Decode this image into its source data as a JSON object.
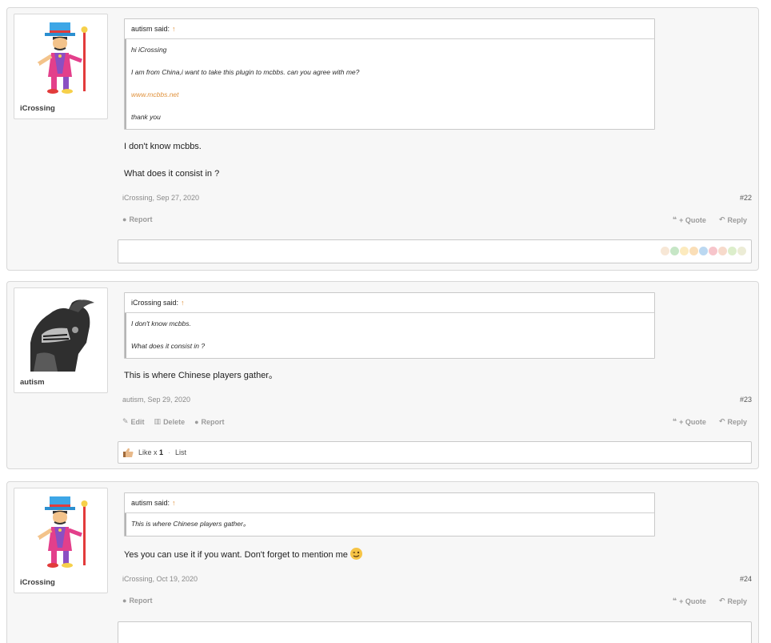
{
  "posts": [
    {
      "author": "iCrossing",
      "avatar": "ringmaster-avatar",
      "quote": {
        "header": "autism said:",
        "lines": [
          {
            "text": "hi iCrossing",
            "link": false
          },
          {
            "text": "I am from China,i want to take this plugin to mcbbs. can you agree with me?",
            "link": false
          },
          {
            "text": "www.mcbbs.net",
            "link": true
          },
          {
            "text": "thank you",
            "link": false
          }
        ]
      },
      "messages": [
        "I don't know mcbbs.",
        "What does it consist in ?"
      ],
      "meta": "iCrossing, Sep 27, 2020",
      "number": "#22",
      "actions": [
        {
          "icon": "report-icon",
          "label": "Report"
        }
      ],
      "right_actions": [
        {
          "icon": "quote-icon",
          "label": "+ Quote"
        },
        {
          "icon": "reply-icon",
          "label": "Reply"
        }
      ]
    },
    {
      "author": "autism",
      "avatar": "knight-helmet-avatar",
      "quote": {
        "header": "iCrossing said:",
        "lines": [
          {
            "text": "I don't know mcbbs.",
            "link": false
          },
          {
            "text": "What does it consist in ?",
            "link": false
          }
        ]
      },
      "messages": [
        "This is where Chinese players gather。"
      ],
      "meta": "autism, Sep 29, 2020",
      "number": "#23",
      "actions": [
        {
          "icon": "edit-icon",
          "label": "Edit"
        },
        {
          "icon": "delete-icon",
          "label": "Delete"
        },
        {
          "icon": "report-icon",
          "label": "Report"
        }
      ],
      "right_actions": [
        {
          "icon": "quote-icon",
          "label": "+ Quote"
        },
        {
          "icon": "reply-icon",
          "label": "Reply"
        }
      ],
      "likes": {
        "prefix": "Like x",
        "count": "1",
        "list_label": "List"
      }
    },
    {
      "author": "iCrossing",
      "avatar": "ringmaster-avatar",
      "quote": {
        "header": "autism said:",
        "lines": [
          {
            "text": "This is where Chinese players gather。",
            "link": false
          }
        ]
      },
      "messages": [
        "Yes you can use it if you want. Don't forget to mention me"
      ],
      "meta": "iCrossing, Oct 19, 2020",
      "number": "#24",
      "actions": [
        {
          "icon": "report-icon",
          "label": "Report"
        }
      ],
      "right_actions": [
        {
          "icon": "quote-icon",
          "label": "+ Quote"
        },
        {
          "icon": "reply-icon",
          "label": "Reply"
        }
      ]
    }
  ],
  "colors": {
    "accent": "#e0913b",
    "staff_corner": "#6ab22f"
  },
  "quote_arrow": "↑"
}
